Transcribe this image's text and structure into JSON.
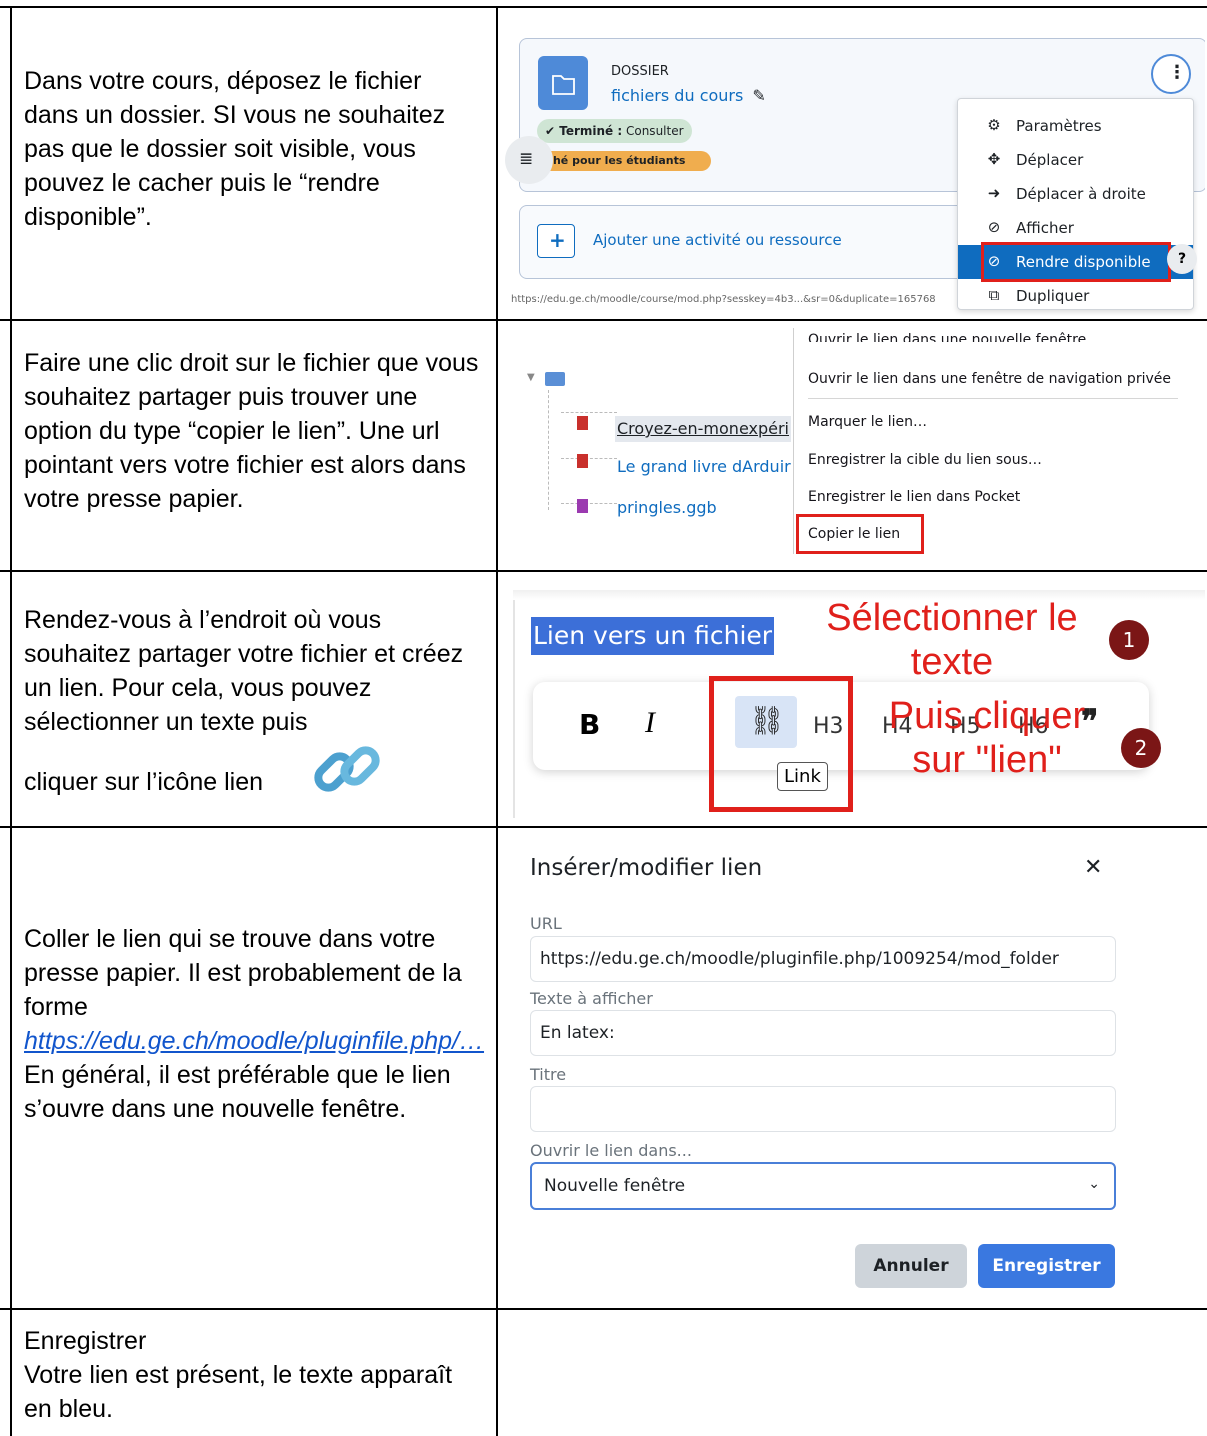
{
  "rows": [
    {
      "text": "Dans votre cours, déposez le fichier dans un dossier. SI vous ne souhaitez pas que le dossier soit visible, vous pouvez le cacher puis le “rendre disponible”."
    },
    {
      "text": "Faire une clic droit sur le fichier que vous souhaitez partager puis trouver une option du type “copier le lien”. Une url pointant vers votre fichier est alors dans votre presse papier."
    },
    {
      "text_a": "Rendez-vous à l’endroit où vous souhaitez partager votre fichier et créez un lien. Pour cela, vous pouvez sélectionner un texte puis",
      "text_b": "cliquer sur l’icône lien"
    },
    {
      "text_a": "Coller le lien qui se trouve dans votre presse papier. Il est probablement de la forme",
      "link": "https://edu.ge.ch/moodle/pluginfile.php/…",
      "text_b": "En général, il est préférable que le lien s’ouvre dans une nouvelle fenêtre."
    },
    {
      "line1": "Enregistrer",
      "line2": "Votre lien est présent, le texte apparaît en bleu."
    }
  ],
  "shot1": {
    "type_label": "DOSSIER",
    "folder_name": "fichiers du cours",
    "completion_label": "✔ Terminé :",
    "completion_value": "Consulter",
    "hidden_badge": "aché pour les étudiants",
    "add_activity": "Ajouter une activité ou ressource",
    "url_fragment": "https://edu.ge.ch/moodle/course/mod.php?sesskey=4b3...&sr=0&duplicate=165768",
    "menu": [
      {
        "icon": "gear",
        "label": "Paramètres"
      },
      {
        "icon": "move",
        "label": "Déplacer"
      },
      {
        "icon": "arrow-right",
        "label": "Déplacer à droite"
      },
      {
        "icon": "eye-slash",
        "label": "Afficher"
      },
      {
        "icon": "ban",
        "label": "Rendre disponible"
      },
      {
        "icon": "copy",
        "label": "Dupliquer"
      }
    ],
    "help_icon": "?"
  },
  "shot2": {
    "files": [
      "Croyez-en-monexpéri",
      "Le grand livre dArduir",
      "pringles.ggb"
    ],
    "menu": [
      "Ouvrir le lien dans une nouvelle fenêtre",
      "Ouvrir le lien dans une fenêtre de navigation privée",
      "Marquer le lien…",
      "Enregistrer la cible du lien sous…",
      "Enregistrer le lien dans Pocket",
      "Copier le lien"
    ]
  },
  "shot3": {
    "selected_text": "Lien vers un fichier",
    "bold": "B",
    "italic": "I",
    "headings": [
      "H3",
      "H4",
      "H5",
      "H6"
    ],
    "quote": "❞",
    "tooltip": "Link",
    "annotation_1_line1": "Sélectionner le",
    "annotation_1_line2": "texte",
    "annotation_2_line1": "Puis cliquer",
    "annotation_2_line2": "sur \"lien\"",
    "step1": "1",
    "step2": "2",
    "accent": "#e0201b"
  },
  "shot4": {
    "title": "Insérer/modifier lien",
    "close": "✕",
    "url_label": "URL",
    "url_value": "https://edu.ge.ch/moodle/pluginfile.php/1009254/mod_folder",
    "text_label": "Texte à afficher",
    "text_value": "En latex:",
    "title_label": "Titre",
    "title_value": "",
    "open_label": "Ouvrir le lien dans...",
    "open_value": "Nouvelle fenêtre",
    "cancel": "Annuler",
    "save": "Enregistrer",
    "primary_color": "#3a78e0"
  }
}
